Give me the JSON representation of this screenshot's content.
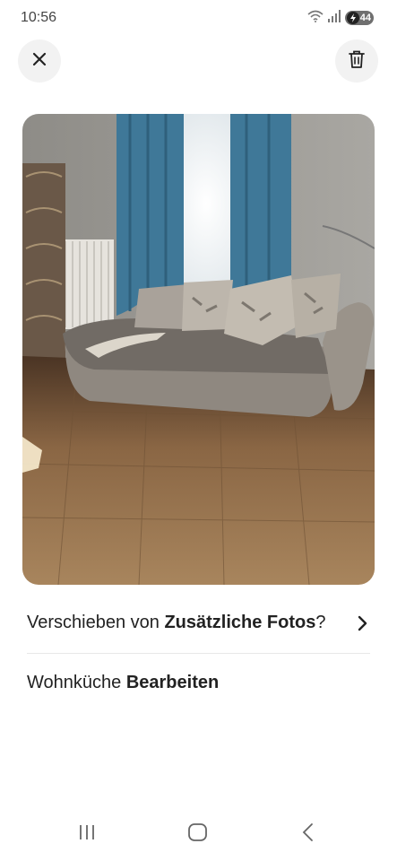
{
  "status_bar": {
    "time": "10:56",
    "battery_level": "44",
    "icons": [
      "wifi-icon",
      "signal-icon",
      "battery-icon"
    ]
  },
  "header": {
    "close_icon": "close-icon",
    "delete_icon": "trash-icon"
  },
  "photo": {
    "description_icon": "room-photo"
  },
  "actions": {
    "move_prefix": "Verschieben von ",
    "move_target": "Zusätzliche Fotos",
    "move_suffix": "?",
    "room_name": "Wohnküche",
    "edit_label": "Bearbeiten"
  },
  "navigation": {
    "items": [
      "recent-apps-icon",
      "home-icon",
      "back-icon"
    ]
  },
  "colors": {
    "text": "#222222",
    "divider": "#e8e8e8",
    "button_bg": "#f2f2f2"
  }
}
